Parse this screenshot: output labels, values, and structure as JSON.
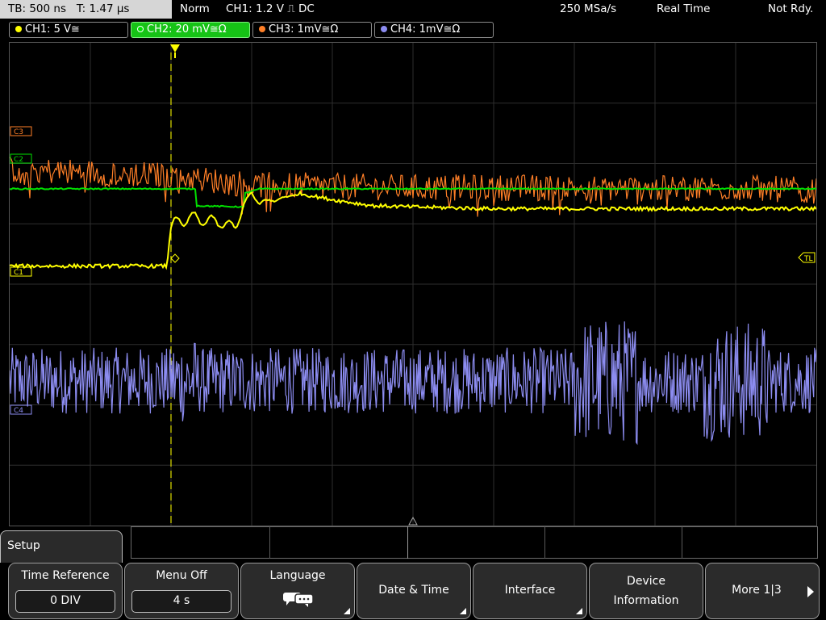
{
  "status": {
    "timebase": "TB: 500 ns   T: 1.47 µs",
    "mode": "Norm",
    "trigger": "CH1: 1.2 V ⎍ DC",
    "sample_rate": "250 MSa/s",
    "acq_mode": "Real Time",
    "state": "Not Rdy."
  },
  "channels": [
    {
      "label": "CH1: 5 V≅",
      "color": "#ffff00"
    },
    {
      "label": "CH2: 20 mV≅Ω",
      "color": "#00e000"
    },
    {
      "label": "CH3: 1mV≅Ω",
      "color": "#ff7f27"
    },
    {
      "label": "CH4: 1mV≅Ω",
      "color": "#8c8cf0"
    }
  ],
  "markers": {
    "ch1": "C1",
    "ch2": "C2",
    "ch3": "C3",
    "ch4": "C4",
    "trigger_level": "TL"
  },
  "setup": {
    "label": "Setup"
  },
  "softkeys": {
    "time_reference": {
      "label": "Time Reference",
      "value": "0 DIV"
    },
    "menu_off": {
      "label": "Menu Off",
      "value": "4 s"
    },
    "language": {
      "label": "Language"
    },
    "date_time": {
      "label": "Date & Time"
    },
    "interface": {
      "label": "Interface"
    },
    "device_info": {
      "label_line1": "Device",
      "label_line2": "Information"
    },
    "more": {
      "label": "More 1|3"
    }
  },
  "chart_data": {
    "type": "line",
    "x_unit": "div",
    "y_unit": "div",
    "xlim": [
      -2,
      8
    ],
    "ylim": [
      -4,
      4
    ],
    "series": [
      {
        "name": "CH1",
        "color": "#ffff00",
        "x": [
          -2.0,
          -0.05,
          -0.05,
          0.0,
          0.2,
          0.5,
          0.8,
          0.9,
          1.0,
          1.1,
          1.3,
          1.6,
          2.0,
          2.5,
          3.0,
          4.0,
          5.0,
          6.0,
          7.0,
          8.0
        ],
        "y": [
          0.3,
          0.3,
          0.3,
          0.95,
          1.1,
          1.05,
          0.95,
          1.3,
          1.5,
          1.35,
          1.4,
          1.5,
          1.4,
          1.3,
          1.28,
          1.25,
          1.25,
          1.25,
          1.25,
          1.25
        ]
      },
      {
        "name": "CH2",
        "color": "#00e000",
        "x": [
          -2.0,
          0.3,
          0.3,
          0.9,
          0.9,
          1.1,
          2.0,
          5.0,
          8.0
        ],
        "y": [
          1.58,
          1.58,
          1.3,
          1.28,
          1.5,
          1.58,
          1.58,
          1.58,
          1.58
        ]
      },
      {
        "name": "CH3",
        "color": "#ff7f27",
        "x": [
          -2.0,
          -1.0,
          0.0,
          0.5,
          1.0,
          2.0,
          3.0,
          4.0,
          5.0,
          6.0,
          7.0,
          8.0
        ],
        "y": [
          1.9,
          1.85,
          1.8,
          1.72,
          1.65,
          1.62,
          1.6,
          1.6,
          1.6,
          1.58,
          1.6,
          1.55
        ]
      },
      {
        "name": "CH4",
        "color": "#8c8cf0",
        "x": [
          -2.0,
          0.0,
          2.0,
          4.0,
          5.0,
          5.5,
          6.0,
          6.7,
          7.2,
          8.0
        ],
        "y": [
          -1.6,
          -1.6,
          -1.6,
          -1.6,
          -1.6,
          -1.6,
          -1.6,
          -1.6,
          -1.6,
          -1.6
        ]
      }
    ],
    "grid": true,
    "trigger_position_div": 0.0,
    "trigger_level": "TL"
  }
}
